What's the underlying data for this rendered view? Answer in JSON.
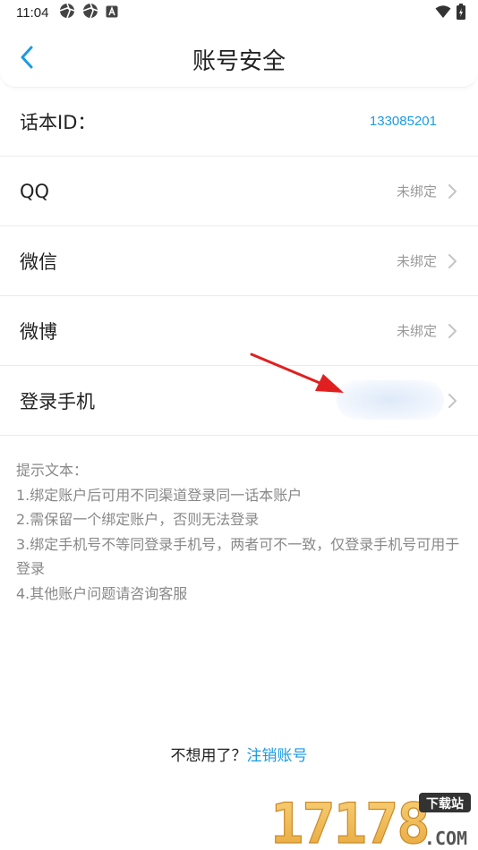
{
  "status_bar": {
    "time": "11:04"
  },
  "header": {
    "title": "账号安全"
  },
  "rows": {
    "id": {
      "label": "话本ID：",
      "value": "133085201"
    },
    "qq": {
      "label": "QQ",
      "value": "未绑定"
    },
    "wechat": {
      "label": "微信",
      "value": "未绑定"
    },
    "weibo": {
      "label": "微博",
      "value": "未绑定"
    },
    "phone": {
      "label": "登录手机",
      "value": ""
    }
  },
  "tips": {
    "title": "提示文本：",
    "lines": [
      "1.绑定账户后可用不同渠道登录同一话本账户",
      "2.需保留一个绑定账户，否则无法登录",
      "3.绑定手机号不等同登录手机号，两者可不一致，仅登录手机号可用于登录",
      "4.其他账户问题请咨询客服"
    ]
  },
  "footer": {
    "prompt": "不想用了？",
    "link": "注销账号"
  },
  "watermark": {
    "text": "17178",
    "badge": "下载站",
    "domain": ".COM"
  },
  "colors": {
    "accent": "#1a9be3",
    "muted": "#999999",
    "annotation_arrow": "#e02020"
  }
}
